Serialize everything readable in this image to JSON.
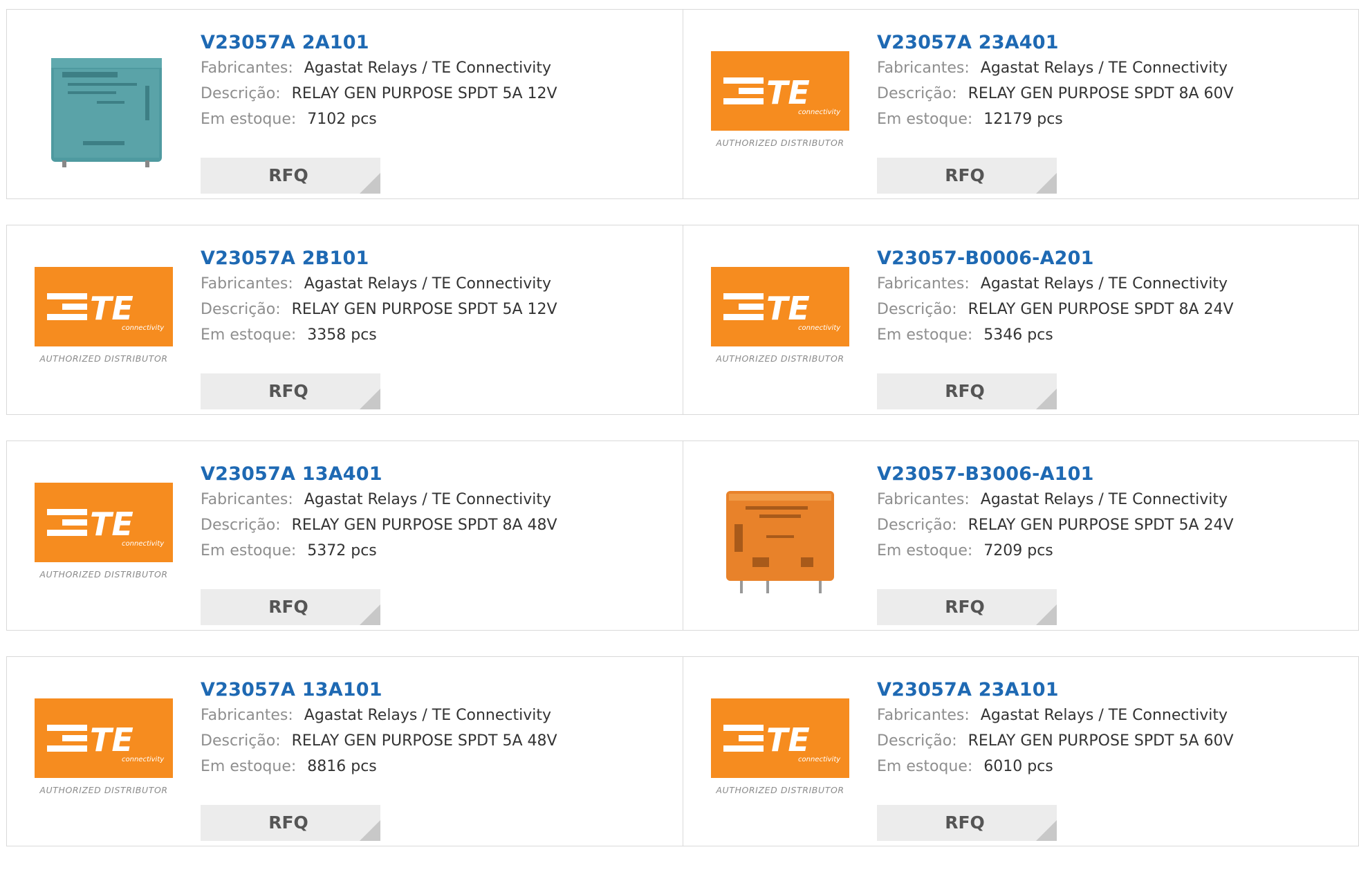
{
  "labels": {
    "manufacturer": "Fabricantes:",
    "description": "Descrição:",
    "stock": "Em estoque:",
    "rfq": "RFQ",
    "authorized_distributor": "AUTHORIZED DISTRIBUTOR"
  },
  "logo": {
    "te_text": "TE",
    "te_sub": "connectivity"
  },
  "colors": {
    "title": "#1e69b3",
    "te_orange": "#f68c1f",
    "label_gray": "#8e8e8e",
    "rfq_bg": "#ececec"
  },
  "products": [
    {
      "part": "V23057A 2A101",
      "manufacturer": "Agastat Relays / TE Connectivity",
      "description": "RELAY GEN PURPOSE SPDT 5A 12V",
      "stock": "7102 pcs",
      "image": "blue-relay-photo"
    },
    {
      "part": "V23057A 23A401",
      "manufacturer": "Agastat Relays / TE Connectivity",
      "description": "RELAY GEN PURPOSE SPDT 8A 60V",
      "stock": "12179 pcs",
      "image": "te-logo"
    },
    {
      "part": "V23057A 2B101",
      "manufacturer": "Agastat Relays / TE Connectivity",
      "description": "RELAY GEN PURPOSE SPDT 5A 12V",
      "stock": "3358 pcs",
      "image": "te-logo"
    },
    {
      "part": "V23057-B0006-A201",
      "manufacturer": "Agastat Relays / TE Connectivity",
      "description": "RELAY GEN PURPOSE SPDT 8A 24V",
      "stock": "5346 pcs",
      "image": "te-logo"
    },
    {
      "part": "V23057A 13A401",
      "manufacturer": "Agastat Relays / TE Connectivity",
      "description": "RELAY GEN PURPOSE SPDT 8A 48V",
      "stock": "5372 pcs",
      "image": "te-logo"
    },
    {
      "part": "V23057-B3006-A101",
      "manufacturer": "Agastat Relays / TE Connectivity",
      "description": "RELAY GEN PURPOSE SPDT 5A 24V",
      "stock": "7209 pcs",
      "image": "orange-relay-photo"
    },
    {
      "part": "V23057A 13A101",
      "manufacturer": "Agastat Relays / TE Connectivity",
      "description": "RELAY GEN PURPOSE SPDT 5A 48V",
      "stock": "8816 pcs",
      "image": "te-logo"
    },
    {
      "part": "V23057A 23A101",
      "manufacturer": "Agastat Relays / TE Connectivity",
      "description": "RELAY GEN PURPOSE SPDT 5A 60V",
      "stock": "6010 pcs",
      "image": "te-logo"
    }
  ]
}
